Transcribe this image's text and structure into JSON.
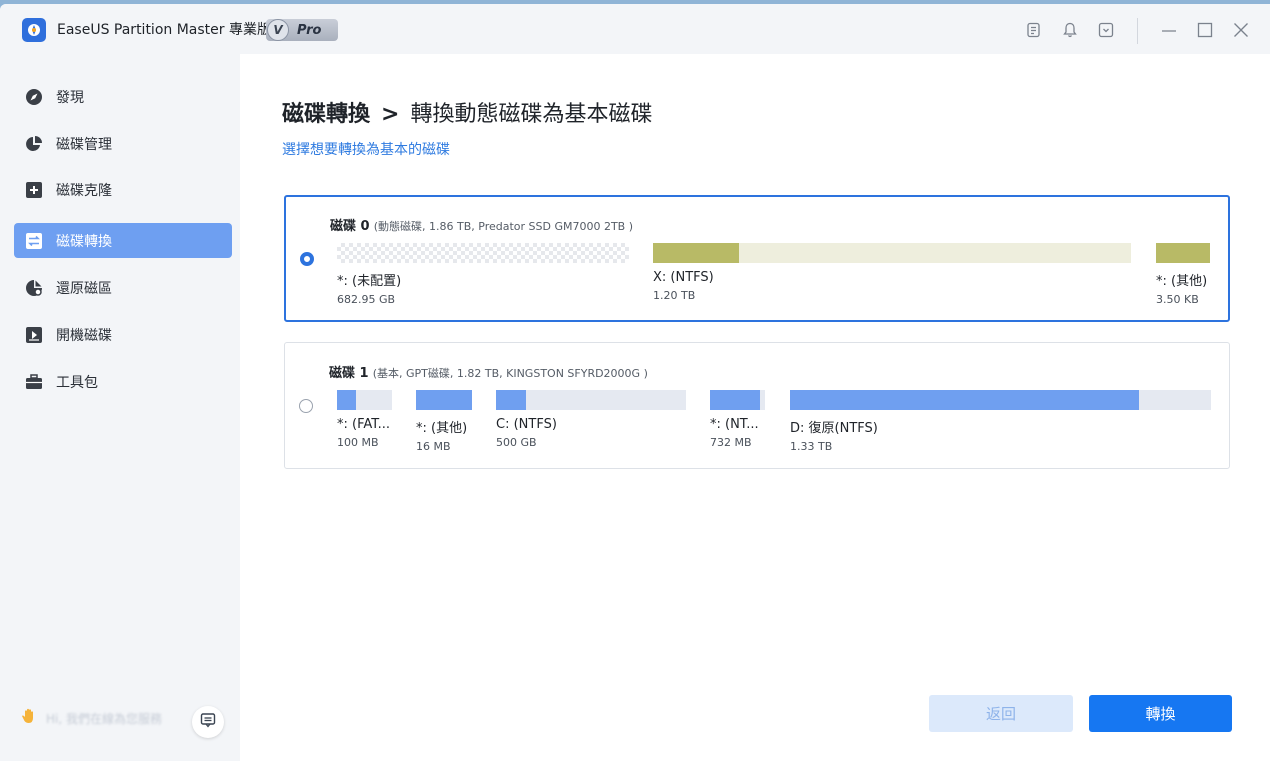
{
  "app": {
    "title": "EaseUS Partition Master 專業版",
    "badge_v": "V",
    "badge_label": "Pro"
  },
  "titlebar_icons": [
    "notes-icon",
    "bell-icon",
    "download-icon",
    "minimize-icon",
    "maximize-icon",
    "close-icon"
  ],
  "sidebar": {
    "items": [
      {
        "label": "發現",
        "icon": "compass-icon",
        "active": false
      },
      {
        "label": "磁碟管理",
        "icon": "pie-chart-icon",
        "active": false
      },
      {
        "label": "磁碟克隆",
        "icon": "clone-icon",
        "active": false
      },
      {
        "label": "磁碟轉換",
        "icon": "convert-icon",
        "active": true
      },
      {
        "label": "還原磁區",
        "icon": "recover-icon",
        "active": false
      },
      {
        "label": "開機磁碟",
        "icon": "bootable-icon",
        "active": false
      },
      {
        "label": "工具包",
        "icon": "toolbox-icon",
        "active": false
      }
    ],
    "help_text": "Hi, 我們在線為您服務"
  },
  "main": {
    "title_bold": "磁碟轉換",
    "title_sep": ">",
    "title_rest": "轉換動態磁碟為基本磁碟",
    "subtitle": "選擇想要轉換為基本的磁碟",
    "disks": [
      {
        "name": "磁碟 0",
        "info": "(動態磁碟, 1.86 TB, Predator SSD GM7000 2TB )",
        "selected": true,
        "partitions": [
          {
            "label": "*: (未配置)",
            "size": "682.95 GB",
            "fill": 0.0,
            "color": "#b8b86a",
            "unallocated": true
          },
          {
            "label": "X: (NTFS)",
            "size": "1.20 TB",
            "fill": 0.18,
            "color": "#b8ba66",
            "track": "#eeeedd"
          },
          {
            "label": "*: (其他)",
            "size": "3.50 KB",
            "fill": 1.0,
            "color": "#b8ba66"
          }
        ]
      },
      {
        "name": "磁碟 1",
        "info": "(基本, GPT磁碟, 1.82 TB, KINGSTON SFYRD2000G )",
        "selected": false,
        "partitions": [
          {
            "label": "*: (FAT...",
            "size": "100 MB",
            "fill": 0.35,
            "color": "#6f9ff0"
          },
          {
            "label": "*: (其他)",
            "size": "16 MB",
            "fill": 1.0,
            "color": "#6f9ff0"
          },
          {
            "label": "C: (NTFS)",
            "size": "500 GB",
            "fill": 0.16,
            "color": "#6f9ff0"
          },
          {
            "label": "*: (NT...",
            "size": "732 MB",
            "fill": 0.9,
            "color": "#6f9ff0"
          },
          {
            "label": "D: 復原(NTFS)",
            "size": "1.33 TB",
            "fill": 0.83,
            "color": "#6f9ff0"
          }
        ]
      }
    ]
  },
  "buttons": {
    "back_label": "返回",
    "convert_label": "轉換"
  }
}
